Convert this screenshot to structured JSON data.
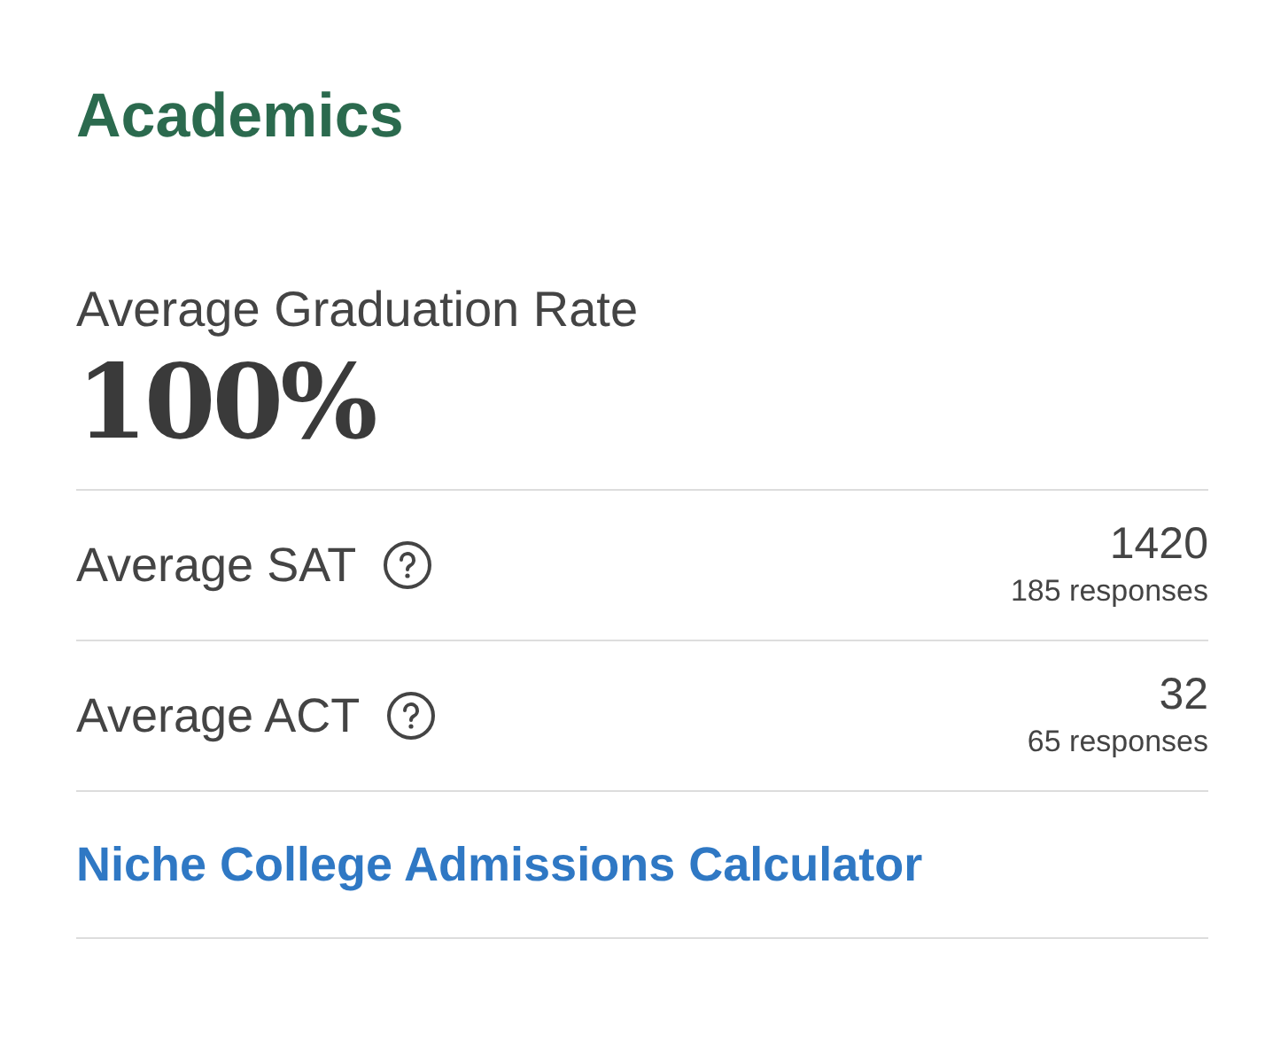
{
  "title": "Academics",
  "graduation": {
    "label": "Average Graduation Rate",
    "value": "100%"
  },
  "scores": [
    {
      "label": "Average SAT",
      "value": "1420",
      "responses": "185 responses"
    },
    {
      "label": "Average ACT",
      "value": "32",
      "responses": "65 responses"
    }
  ],
  "link": "Niche College Admissions Calculator"
}
